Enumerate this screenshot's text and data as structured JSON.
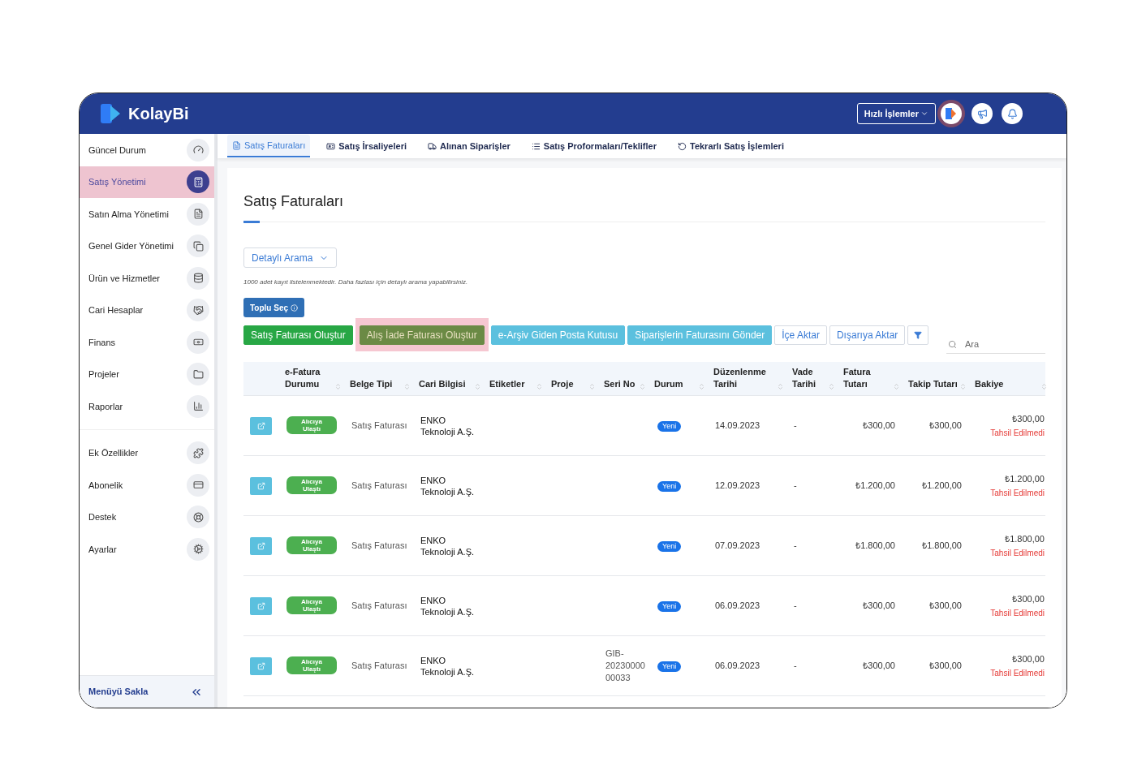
{
  "header": {
    "logo": "KolayBi",
    "quick_actions": "Hızlı İşlemler"
  },
  "sidebar": {
    "items": [
      {
        "label": "Güncel Durum",
        "selected": false,
        "divider_after": false
      },
      {
        "label": "Satış Yönetimi",
        "selected": true,
        "divider_after": false
      },
      {
        "label": "Satın Alma Yönetimi",
        "selected": false,
        "divider_after": false
      },
      {
        "label": "Genel Gider Yönetimi",
        "selected": false,
        "divider_after": false
      },
      {
        "label": "Ürün ve Hizmetler",
        "selected": false,
        "divider_after": false
      },
      {
        "label": "Cari Hesaplar",
        "selected": false,
        "divider_after": false
      },
      {
        "label": "Finans",
        "selected": false,
        "divider_after": false
      },
      {
        "label": "Projeler",
        "selected": false,
        "divider_after": false
      },
      {
        "label": "Raporlar",
        "selected": false,
        "divider_after": true
      },
      {
        "label": "Ek Özellikler",
        "selected": false,
        "divider_after": false
      },
      {
        "label": "Abonelik",
        "selected": false,
        "divider_after": false
      },
      {
        "label": "Destek",
        "selected": false,
        "divider_after": false
      },
      {
        "label": "Ayarlar",
        "selected": false,
        "divider_after": false
      }
    ],
    "hide_menu": "Menüyü Sakla"
  },
  "tabs": [
    {
      "label": "Satış Faturaları",
      "selected": true
    },
    {
      "label": "Satış İrsaliyeleri",
      "selected": false
    },
    {
      "label": "Alınan Siparişler",
      "selected": false
    },
    {
      "label": "Satış Proformaları/Teklifler",
      "selected": false
    },
    {
      "label": "Tekrarlı Satış İşlemleri",
      "selected": false
    }
  ],
  "page_title": "Satış Faturaları",
  "detailed_search": "Detaylı Arama",
  "note": "1000 adet kayıt listelenmektedir. Daha fazlası için detaylı arama yapabilirsiniz.",
  "bulk_select": "Toplu Seç",
  "actions": [
    {
      "kind": "green",
      "label": "Satış Faturası Oluştur",
      "highlighted": false
    },
    {
      "kind": "olive",
      "label": "Alış İade Faturası Oluştur",
      "highlighted": true
    },
    {
      "kind": "cyan",
      "label": "e-Arşiv Giden Posta Kutusu",
      "highlighted": false
    },
    {
      "kind": "cyan",
      "label": "Siparişlerin Faturasını Gönder",
      "highlighted": false
    },
    {
      "kind": "outline",
      "label": "İçe Aktar",
      "highlighted": false
    },
    {
      "kind": "outline",
      "label": "Dışarıya Aktar",
      "highlighted": false
    },
    {
      "kind": "filter",
      "highlighted": false
    }
  ],
  "search": {
    "placeholder": "Ara"
  },
  "table": {
    "columns": [
      "e-Fatura Durumu",
      "Belge Tipi",
      "Cari Bilgisi",
      "Etiketler",
      "Proje",
      "Seri No",
      "Durum",
      "Düzenlenme Tarihi",
      "Vade Tarihi",
      "Fatura Tutarı",
      "Takip Tutarı",
      "Bakiye"
    ],
    "rows": [
      {
        "efatura": "Alıcıya Ulaştı",
        "type": "Satış Faturası",
        "customer": "ENKO Teknoloji A.Ş.",
        "serial": "",
        "status": "Yeni",
        "date": "14.09.2023",
        "due": "-",
        "amount": "₺300,00",
        "tracking": "₺300,00",
        "balance": "₺300,00",
        "balance_status": "Tahsil Edilmedi"
      },
      {
        "efatura": "Alıcıya Ulaştı",
        "type": "Satış Faturası",
        "customer": "ENKO Teknoloji A.Ş.",
        "serial": "",
        "status": "Yeni",
        "date": "12.09.2023",
        "due": "-",
        "amount": "₺1.200,00",
        "tracking": "₺1.200,00",
        "balance": "₺1.200,00",
        "balance_status": "Tahsil Edilmedi"
      },
      {
        "efatura": "Alıcıya Ulaştı",
        "type": "Satış Faturası",
        "customer": "ENKO Teknoloji A.Ş.",
        "serial": "",
        "status": "Yeni",
        "date": "07.09.2023",
        "due": "-",
        "amount": "₺1.800,00",
        "tracking": "₺1.800,00",
        "balance": "₺1.800,00",
        "balance_status": "Tahsil Edilmedi"
      },
      {
        "efatura": "Alıcıya Ulaştı",
        "type": "Satış Faturası",
        "customer": "ENKO Teknoloji A.Ş.",
        "serial": "",
        "status": "Yeni",
        "date": "06.09.2023",
        "due": "-",
        "amount": "₺300,00",
        "tracking": "₺300,00",
        "balance": "₺300,00",
        "balance_status": "Tahsil Edilmedi"
      },
      {
        "efatura": "Alıcıya Ulaştı",
        "type": "Satış Faturası",
        "customer": "ENKO Teknoloji A.Ş.",
        "serial": "GIB-20230000 00033",
        "status": "Yeni",
        "date": "06.09.2023",
        "due": "-",
        "amount": "₺300,00",
        "tracking": "₺300,00",
        "balance": "₺300,00",
        "balance_status": "Tahsil Edilmedi"
      }
    ]
  }
}
